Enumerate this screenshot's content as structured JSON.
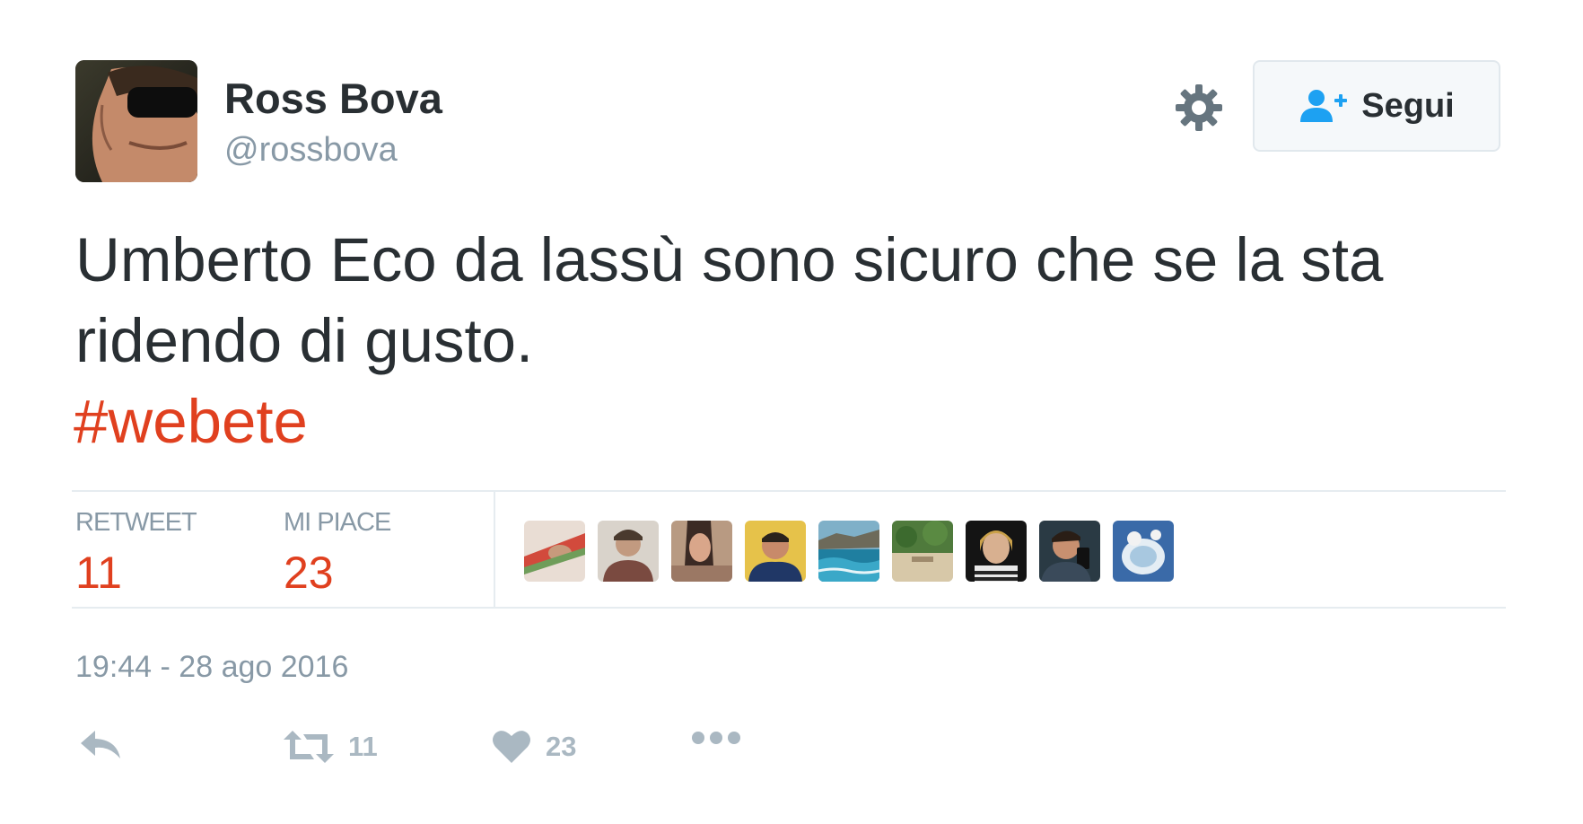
{
  "user": {
    "name": "Ross Bova",
    "handle": "@rossbova"
  },
  "follow_button": {
    "label": "Segui",
    "icon": "user-add-icon"
  },
  "settings_icon": "gear-icon",
  "tweet": {
    "text": "Umberto Eco da lassù sono sicuro che se la sta ridendo di gusto.",
    "hashtag": "#webete"
  },
  "stats": {
    "retweet_label": "RETWEET",
    "retweet_count": "11",
    "likes_label": "MI PIACE",
    "likes_count": "23"
  },
  "likers_avatars_count": 9,
  "timestamp": "19:44 - 28 ago 2016",
  "actions": {
    "reply_icon": "reply-icon",
    "retweet_icon": "retweet-icon",
    "retweet_count": "11",
    "like_icon": "heart-icon",
    "like_count": "23",
    "more_icon": "more-icon"
  },
  "colors": {
    "accent": "#e0401f",
    "muted": "#8899a6",
    "text": "#292f33",
    "follow_icon": "#1da1f2"
  }
}
